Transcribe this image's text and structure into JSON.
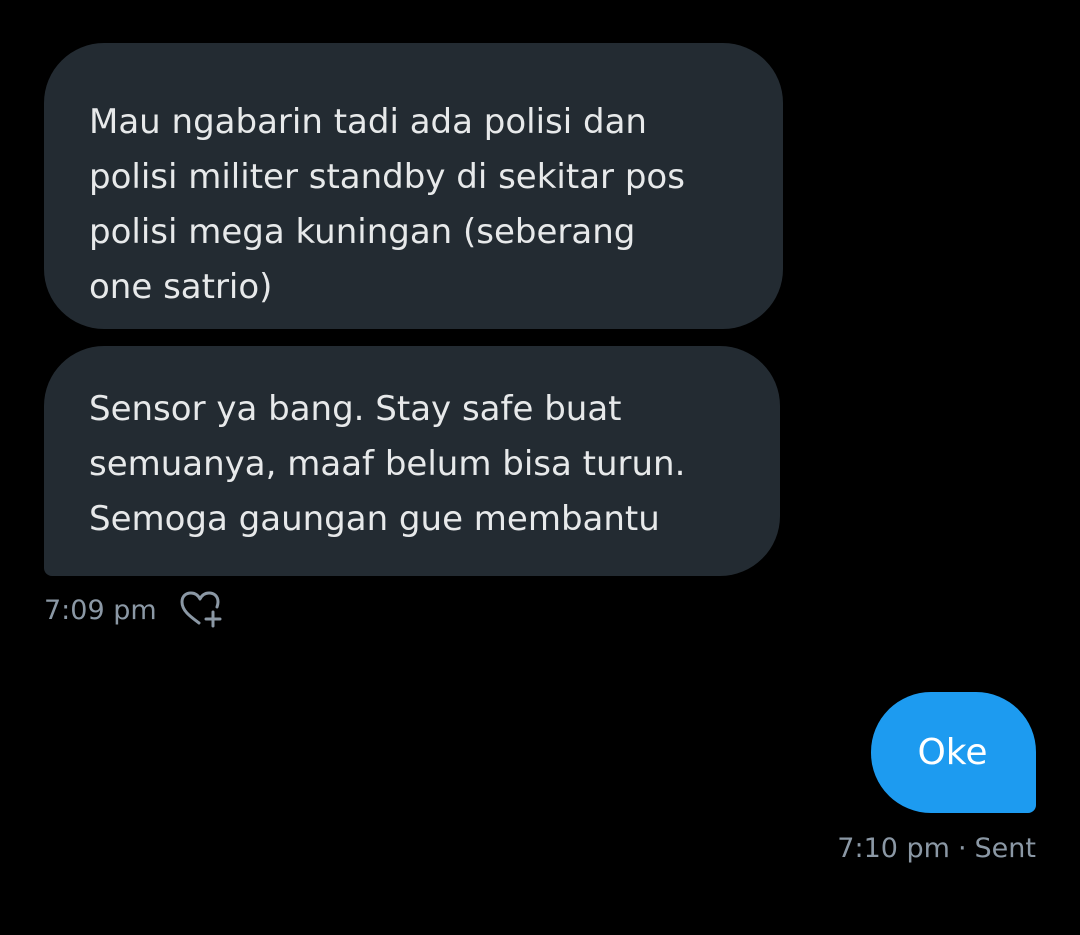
{
  "conversation": {
    "received": [
      {
        "lines": [
          "Mau ngabarin tadi ada polisi dan",
          "polisi militer standby di sekitar pos",
          "polisi mega kuningan (seberang",
          "one satrio)"
        ]
      },
      {
        "lines": [
          "Sensor ya bang. Stay safe buat",
          "semuanya, maaf belum bisa turun.",
          "Semoga gaungan gue membantu"
        ]
      }
    ],
    "received_time": "7:09 pm",
    "react_icon": "heart-plus-icon",
    "sent": {
      "text": "Oke",
      "time": "7:10 pm",
      "separator": "·",
      "status": "Sent"
    }
  },
  "colors": {
    "background": "#000000",
    "received_bubble": "#232B32",
    "received_text": "#E7E9EA",
    "sent_bubble": "#1D9BF0",
    "sent_text": "#FFFFFF",
    "meta_text": "#8B98A5"
  }
}
